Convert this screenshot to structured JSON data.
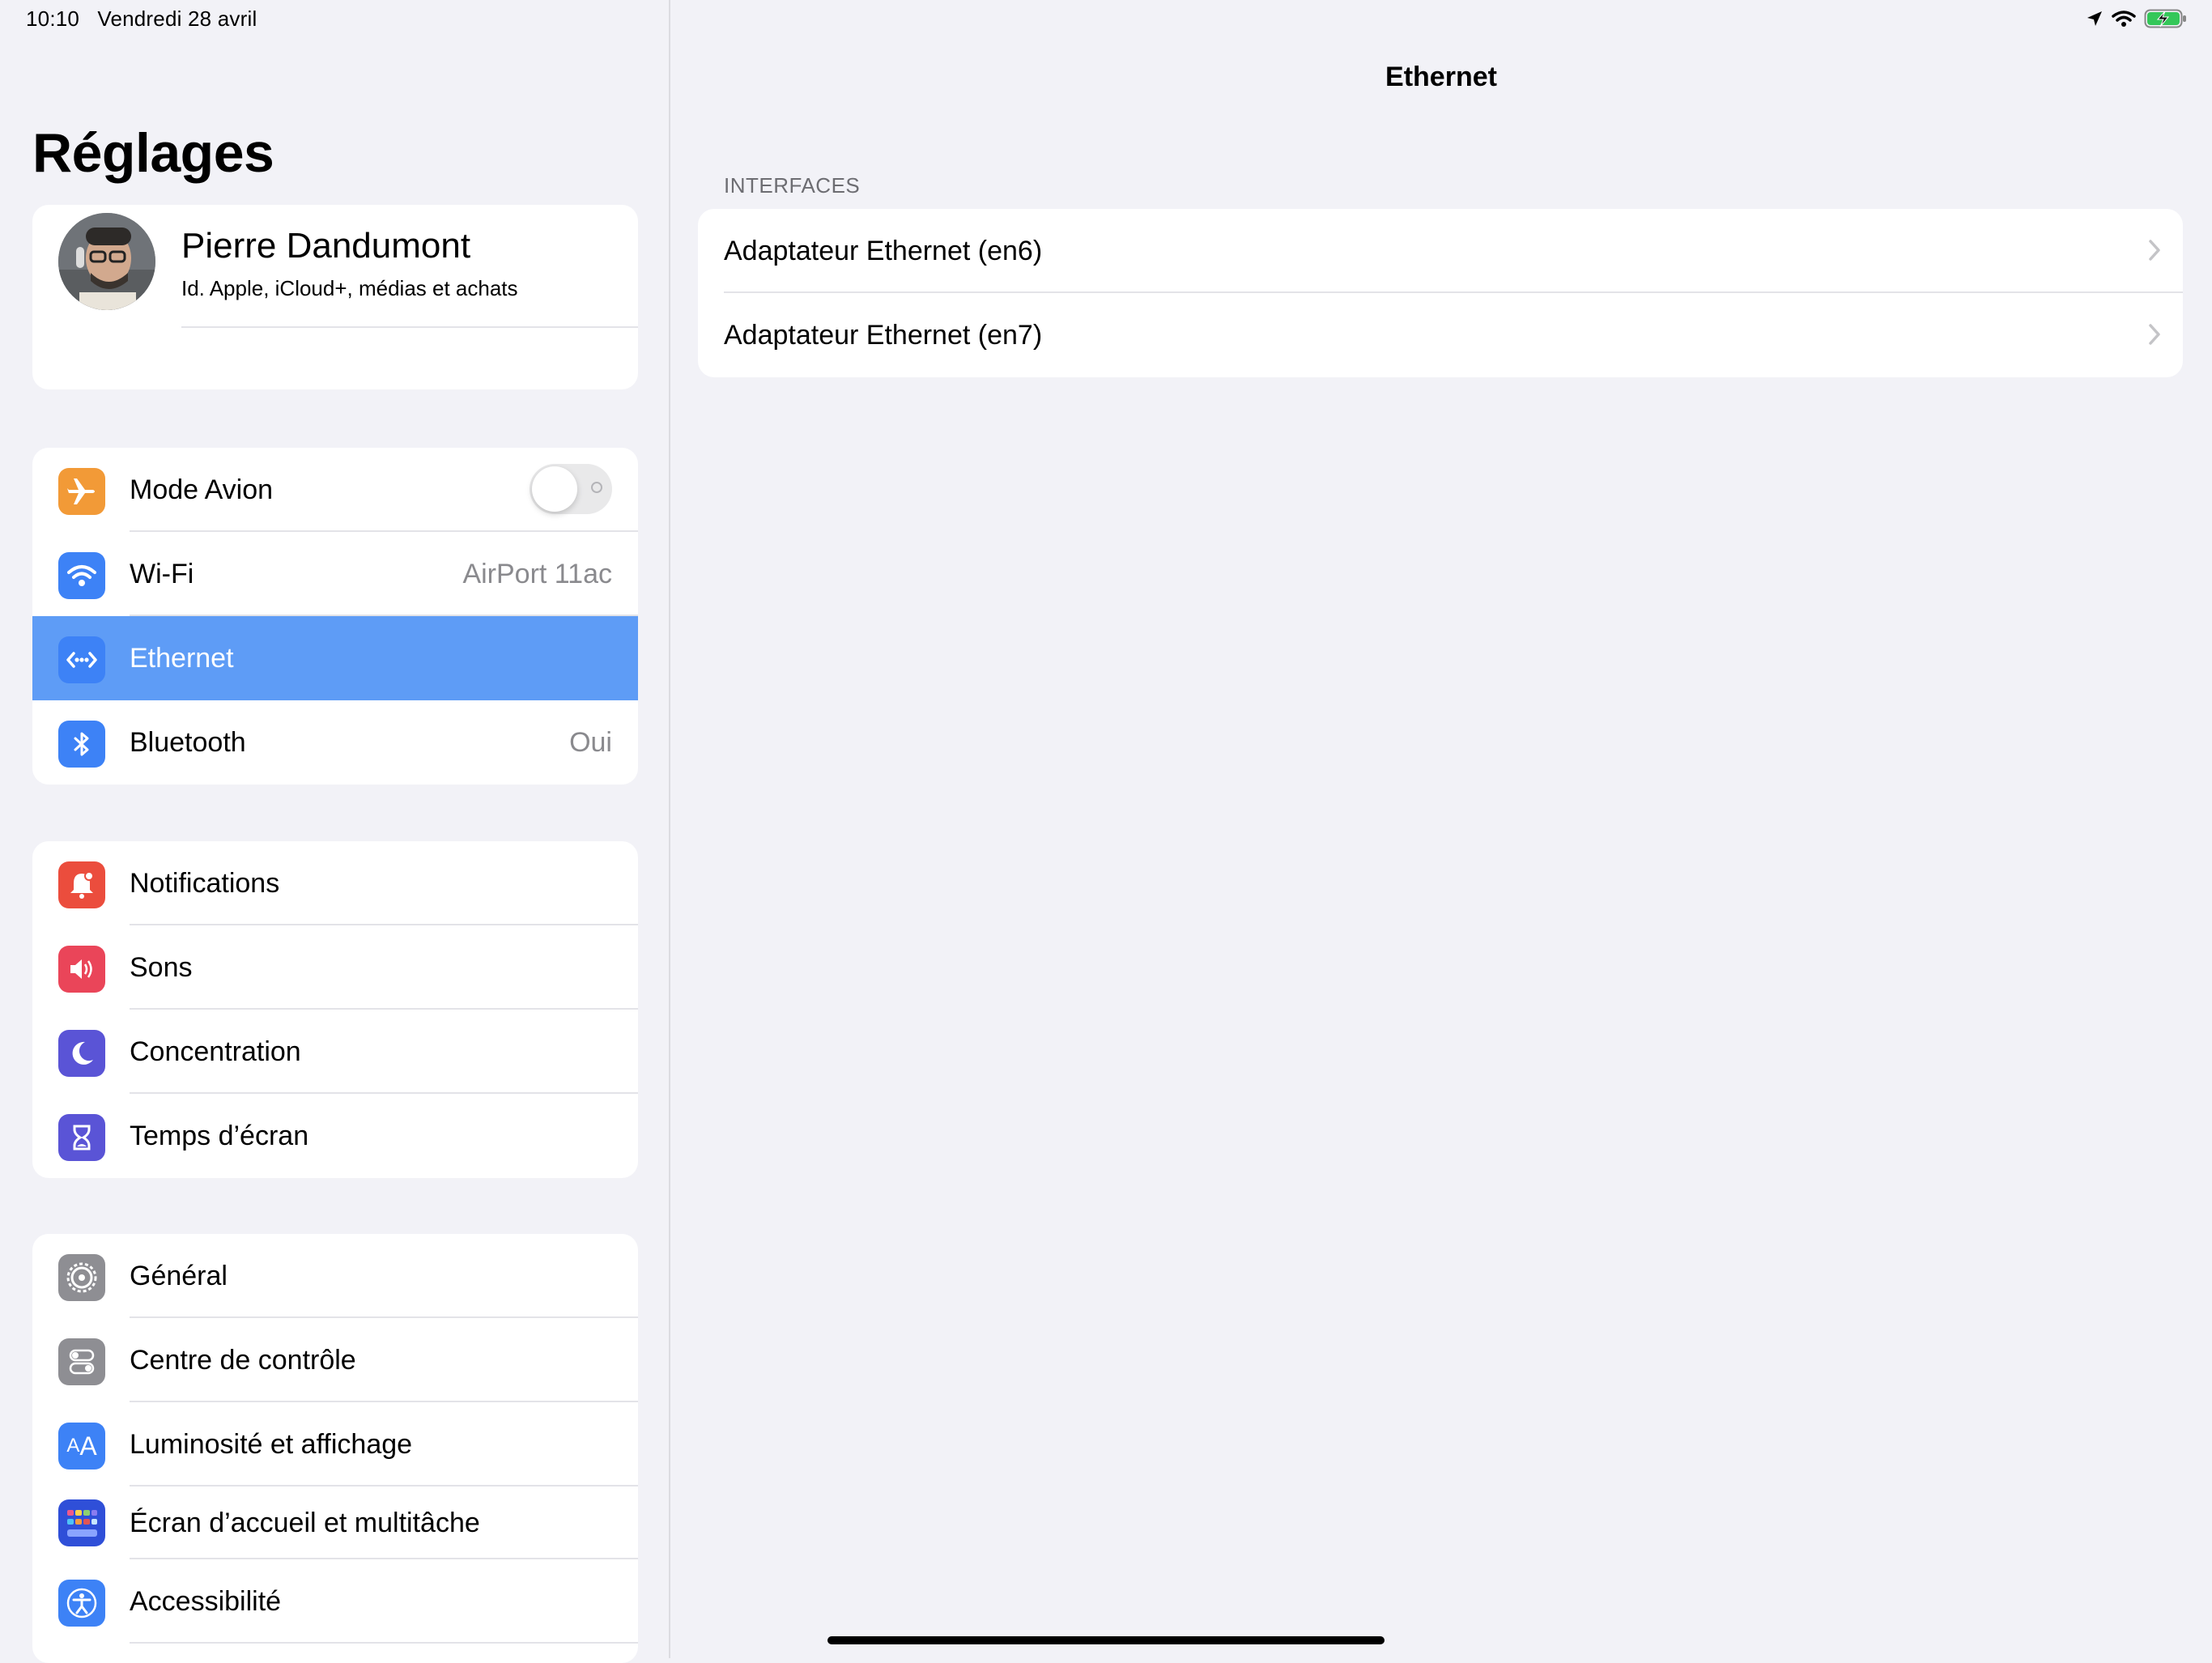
{
  "status_bar": {
    "time_date": "10:10   Vendredi 28 avril",
    "icons": [
      "location-icon",
      "wifi-icon",
      "battery-charging-icon"
    ]
  },
  "sidebar": {
    "title": "Réglages",
    "profile": {
      "name": "Pierre Dandumont",
      "subtitle": "Id. Apple, iCloud+, médias et achats"
    },
    "group1": [
      {
        "label": "Mode Avion",
        "icon": "airplane-icon",
        "color": "#f29a37",
        "toggle": false
      },
      {
        "label": "Wi-Fi",
        "value": "AirPort 11ac",
        "icon": "wifi-icon",
        "color": "#3d82f6"
      },
      {
        "label": "Ethernet",
        "icon": "ethernet-icon",
        "color": "#3d82f6",
        "selected": true
      },
      {
        "label": "Bluetooth",
        "value": "Oui",
        "icon": "bluetooth-icon",
        "color": "#3d82f6"
      }
    ],
    "group2": [
      {
        "label": "Notifications",
        "icon": "bell-icon",
        "color": "#eb4d3d"
      },
      {
        "label": "Sons",
        "icon": "speaker-icon",
        "color": "#ea4559"
      },
      {
        "label": "Concentration",
        "icon": "moon-icon",
        "color": "#5a54d6"
      },
      {
        "label": "Temps d’écran",
        "icon": "hourglass-icon",
        "color": "#5a54d6"
      }
    ],
    "group3": [
      {
        "label": "Général",
        "icon": "gear-icon",
        "color": "#8e8e93"
      },
      {
        "label": "Centre de contrôle",
        "icon": "toggles-icon",
        "color": "#8e8e93"
      },
      {
        "label": "Luminosité et affichage",
        "icon": "text-size-icon",
        "color": "#3d82f6"
      },
      {
        "label": "Écran d’accueil et multitâche",
        "icon": "home-grid-icon",
        "color": "#2f4fd8"
      },
      {
        "label": "Accessibilité",
        "icon": "accessibility-icon",
        "color": "#3d82f6"
      }
    ]
  },
  "detail": {
    "title": "Ethernet",
    "section_header": "INTERFACES",
    "interfaces": [
      {
        "label": "Adaptateur Ethernet (en6)"
      },
      {
        "label": "Adaptateur Ethernet (en7)"
      }
    ]
  }
}
